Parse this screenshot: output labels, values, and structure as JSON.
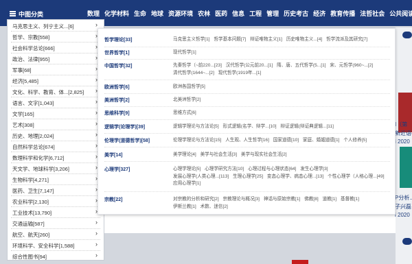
{
  "header": {
    "menu_label": "中图分类",
    "nav": [
      "数理",
      "化学材料",
      "生命",
      "地球",
      "资源环境",
      "农林",
      "医药",
      "信息",
      "工程",
      "管理",
      "历史考古",
      "经济",
      "教育传播",
      "法哲社会",
      "公共阅读"
    ]
  },
  "categories": [
    "马克思主义、列宁主义...[6]",
    "哲学、宗教[558]",
    "社会科学总论[666]",
    "政治、法律[955]",
    "军事[68]",
    "经济[5,485]",
    "文化、科学、教育、体...[2,825]",
    "语言、文字[1,043]",
    "文学[165]",
    "艺术[308]",
    "历史、地理[2,024]",
    "自然科学总论[674]",
    "数理科学和化学[6,712]",
    "天文学、地球科学[3,206]",
    "生物科学[4,271]",
    "医药、卫生[7,147]",
    "农业科学[2,130]",
    "工业技术[13,790]",
    "交通运输[587]",
    "航空、航天[260]",
    "环境科学、安全科学[1,588]",
    "综合性图书[94]"
  ],
  "subpanel": [
    {
      "name": "哲学理论[33]",
      "links": [
        "马克思主义哲学[1]",
        "哲学基本问题[7]",
        "辩证唯物主义[1]",
        "历史唯物主义...[4]",
        "哲学流派及其研究[7]"
      ]
    },
    {
      "name": "世界哲学[1]",
      "links": [
        "现代哲学[1]"
      ]
    },
    {
      "name": "中国哲学[32]",
      "links": [
        "先秦哲学（~前220...[23]",
        "汉代哲学(公元前20...[1]",
        "隋、唐、五代哲学(5...[1]",
        "宋、元哲学(960~...[2]",
        "清代哲学(1644~...[2]",
        "现代哲学(1919年...[1]"
      ]
    },
    {
      "name": "欧洲哲学[6]",
      "links": [
        "欧洲各国哲学[5]"
      ]
    },
    {
      "name": "美洲哲学[2]",
      "links": [
        "北美洲哲学[2]"
      ]
    },
    {
      "name": "思维科学[9]",
      "links": [
        "思维方式[6]"
      ]
    },
    {
      "name": "逻辑学(论理学)[39]",
      "links": [
        "逻辑学理论与方法论[5]",
        "形式逻辑(名学、辩学...[10]",
        "辩证逻辑(辩证典逻辑...[11]"
      ]
    },
    {
      "name": "伦理学(道德哲学)[58]",
      "links": [
        "伦理学理论与方法论[15]",
        "人生观、人生哲学[16]",
        "国家道德[10]",
        "家庭、婚姻道德[1]",
        "个人修养[5]"
      ]
    },
    {
      "name": "美学[14]",
      "links": [
        "美学理论[4]",
        "美学与社会生活[3]",
        "美学与现实社会生活[2]"
      ]
    },
    {
      "name": "心理学[327]",
      "links": [
        "心理学理论[5]",
        "心理学研究方法[10]",
        "心理过程与心理状态[64]",
        "发生心理学[3]",
        "发展心理学(人类心理...[113]",
        "生理心理学[25]",
        "变态心理学、病态心理...[13]",
        "个性心理学（人格心理...[49]",
        "应用心理学[1]"
      ]
    },
    {
      "name": "宗教[22]",
      "links": [
        "对宗教的分析和研究[2]",
        "宗教理论与概况[3]",
        "神话与原始宗教[1]",
        "佛教[8]",
        "道教[1]",
        "基督教[1]",
        "伊斯兰教[1]",
        "术数、迷信[2]"
      ]
    }
  ],
  "right": {
    "t1": "I（第",
    "t2": "新近语等",
    "t3": "i 2020",
    "t4": "P分析...",
    "t5": "子兴磊 主",
    "t6": "i 2020",
    "chip": "查"
  }
}
